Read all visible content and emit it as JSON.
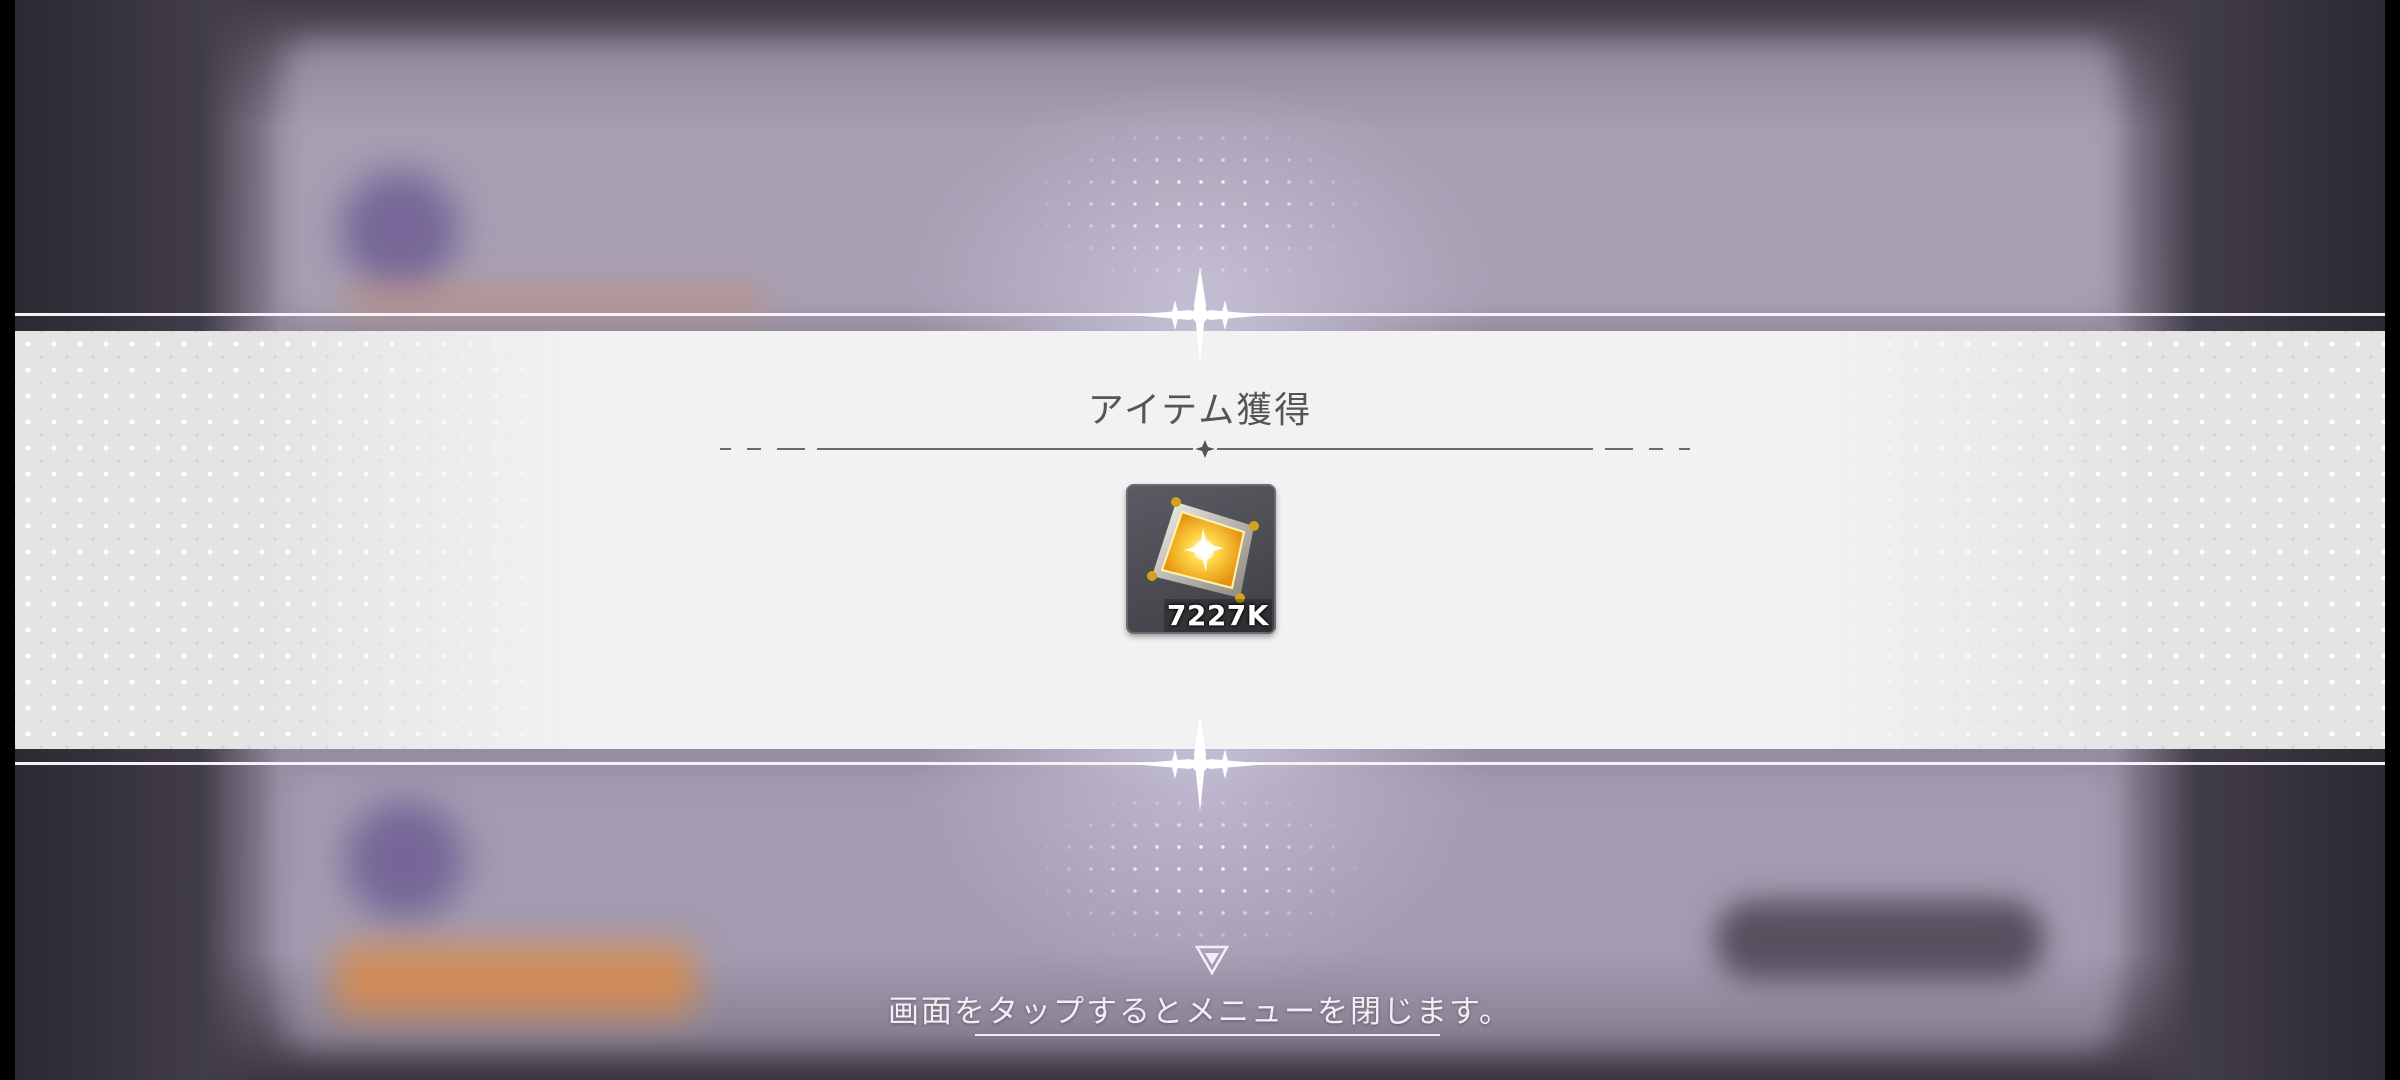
{
  "dialog": {
    "title": "アイテム獲得",
    "hint": "画面をタップするとメニューを閉じます。"
  },
  "reward": {
    "icon": "gold-crystal-icon",
    "count_label": "7227K"
  },
  "colors": {
    "banner": "#f2f2f2",
    "title_text": "#555557",
    "hint_text": "#f1eef6",
    "crystal_gold": "#f5b21c"
  }
}
